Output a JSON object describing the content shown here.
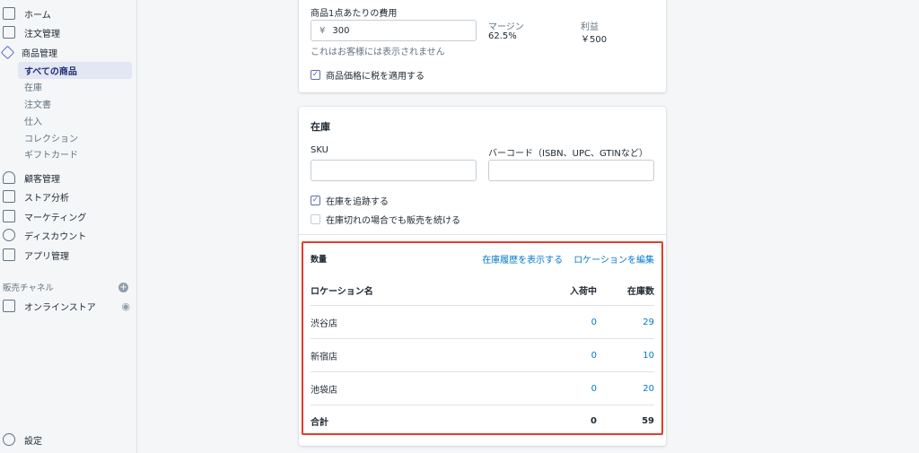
{
  "sidebar": {
    "items": [
      {
        "label": "ホーム",
        "icon": "home-icon"
      },
      {
        "label": "注文管理",
        "icon": "inbox-icon"
      },
      {
        "label": "商品管理",
        "icon": "tag-icon"
      }
    ],
    "sub_items": [
      {
        "label": "すべての商品",
        "active": true
      },
      {
        "label": "在庫"
      },
      {
        "label": "注文書"
      },
      {
        "label": "仕入"
      },
      {
        "label": "コレクション"
      },
      {
        "label": "ギフトカード"
      }
    ],
    "items2": [
      {
        "label": "顧客管理",
        "icon": "person-icon"
      },
      {
        "label": "ストア分析",
        "icon": "bar-chart-icon"
      },
      {
        "label": "マーケティング",
        "icon": "megaphone-icon"
      },
      {
        "label": "ディスカウント",
        "icon": "discount-icon"
      },
      {
        "label": "アプリ管理",
        "icon": "apps-icon"
      }
    ],
    "channels_label": "販売チャネル",
    "online_store": "オンラインストア",
    "settings": "設定"
  },
  "pricing": {
    "cost_label": "商品1点あたりの費用",
    "currency": "¥",
    "cost_value": "300",
    "cost_help": "これはお客様には表示されません",
    "margin_label": "マージン",
    "margin_value": "62.5%",
    "profit_label": "利益",
    "profit_value": "￥500",
    "tax_label": "商品価格に税を適用する",
    "tax_checked": true
  },
  "inventory": {
    "title": "在庫",
    "sku_label": "SKU",
    "sku_value": "",
    "barcode_label": "バーコード（ISBN、UPC、GTINなど）",
    "barcode_value": "",
    "track_label": "在庫を追跡する",
    "track_checked": true,
    "continue_label": "在庫切れの場合でも販売を続ける",
    "continue_checked": false,
    "quantity": {
      "title": "数量",
      "history_link": "在庫履歴を表示する",
      "edit_link": "ロケーションを編集",
      "columns": [
        "ロケーション名",
        "入荷中",
        "在庫数"
      ],
      "rows": [
        {
          "name": "渋谷店",
          "incoming": "0",
          "available": "29"
        },
        {
          "name": "新宿店",
          "incoming": "0",
          "available": "10"
        },
        {
          "name": "池袋店",
          "incoming": "0",
          "available": "20"
        }
      ],
      "total": {
        "name": "合計",
        "incoming": "0",
        "available": "59"
      }
    }
  },
  "colors": {
    "accent": "#5c6ac4",
    "link": "#007ace",
    "highlight": "#e53b2b"
  }
}
